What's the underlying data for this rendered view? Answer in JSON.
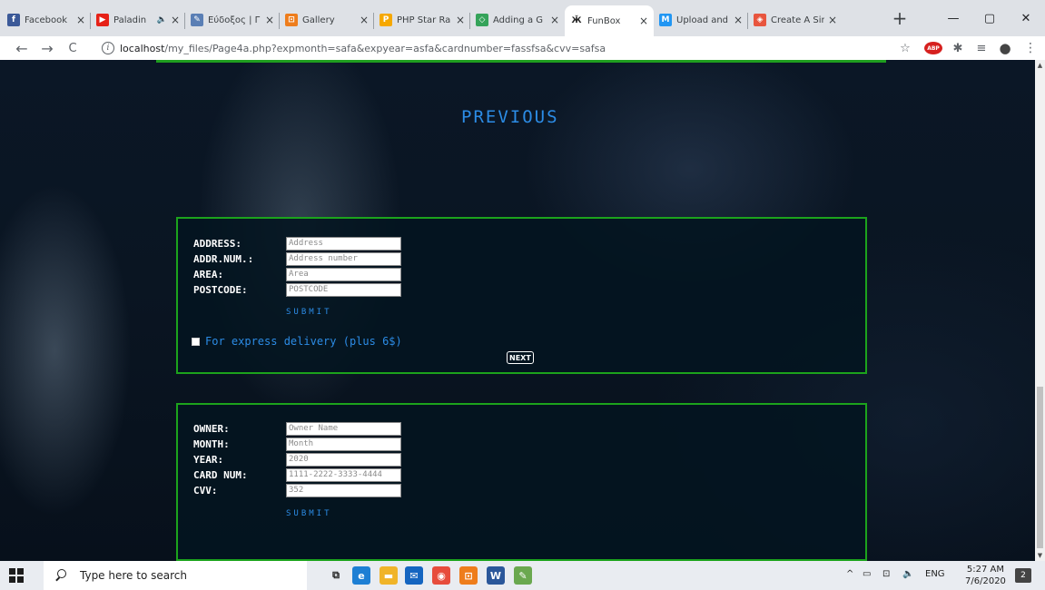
{
  "browser": {
    "tabs": [
      {
        "title": "Facebook",
        "icon": "facebook-icon",
        "color": "#3b5998",
        "glyph": "f"
      },
      {
        "title": "Paladin",
        "icon": "youtube-icon",
        "color": "#e62117",
        "glyph": "▶",
        "audio": "🔈"
      },
      {
        "title": "Εύδοξος | Γ",
        "icon": "eudoxus-icon",
        "color": "#5a7fb5",
        "glyph": "✎"
      },
      {
        "title": "Gallery",
        "icon": "gallery-icon",
        "color": "#ee7d1c",
        "glyph": "⊡"
      },
      {
        "title": "PHP Star Ra",
        "icon": "php-icon",
        "color": "#f6a800",
        "glyph": "P"
      },
      {
        "title": "Adding a G",
        "icon": "code-icon",
        "color": "#35a35a",
        "glyph": "◇"
      },
      {
        "title": "FunBox",
        "icon": "funbox-icon",
        "color": "#ffffff",
        "glyph": "Ӂ"
      },
      {
        "title": "Upload and",
        "icon": "mailchimp-icon",
        "color": "#2196f3",
        "glyph": "M"
      },
      {
        "title": "Create A Sin",
        "icon": "create-icon",
        "color": "#e8553e",
        "glyph": "◈"
      }
    ],
    "close_glyph": "×",
    "new_tab_glyph": "+",
    "window": {
      "minimize": "—",
      "restore": "▢",
      "close": "✕"
    },
    "nav": {
      "back": "←",
      "forward": "→",
      "reload": "C"
    },
    "url_host": "localhost",
    "url_path": "/my_files/Page4a.php?expmonth=safa&expyear=asfa&cardnumber=fassfsa&cvv=safsa",
    "extensions": {
      "star": "☆",
      "abp": "ABP",
      "puzzle": "✱",
      "media": "≡",
      "profile": "●",
      "menu": "⋮"
    }
  },
  "page": {
    "previous_label": "PREVIOUS",
    "address_form": {
      "fields": [
        {
          "label": "ADDRESS:",
          "placeholder": "Address"
        },
        {
          "label": "ADDR.NUM.:",
          "placeholder": "Address number"
        },
        {
          "label": "AREA:",
          "placeholder": "Area"
        },
        {
          "label": "POSTCODE:",
          "placeholder": "POSTCODE"
        }
      ],
      "submit_label": "SUBMIT",
      "express_label": "For express delivery (plus 6$)",
      "next_label": "NEXT"
    },
    "card_form": {
      "fields": [
        {
          "label": "OWNER:",
          "placeholder": "Owner Name"
        },
        {
          "label": "MONTH:",
          "placeholder": "Month"
        },
        {
          "label": "YEAR:",
          "placeholder": "2020"
        },
        {
          "label": "CARD NUM:",
          "placeholder": "1111-2222-3333-4444"
        },
        {
          "label": "CVV:",
          "placeholder": "352"
        }
      ],
      "submit_label": "SUBMIT"
    },
    "colors": {
      "panel_border": "#1ca31c",
      "link": "#2c8ce6"
    }
  },
  "taskbar": {
    "search_placeholder": "Type here to search",
    "apps": [
      {
        "name": "task-view-icon",
        "glyph": "⧉",
        "color": "#e9ecf1"
      },
      {
        "name": "edge-icon",
        "glyph": "e",
        "color": "#1e7fd4"
      },
      {
        "name": "file-explorer-icon",
        "glyph": "▬",
        "color": "#f0b429"
      },
      {
        "name": "mail-icon",
        "glyph": "✉",
        "color": "#1565c0"
      },
      {
        "name": "chrome-icon",
        "glyph": "◉",
        "color": "#e74c3c"
      },
      {
        "name": "gallery-app-icon",
        "glyph": "⊡",
        "color": "#ee7d1c"
      },
      {
        "name": "word-icon",
        "glyph": "W",
        "color": "#2b579a"
      },
      {
        "name": "notepad-icon",
        "glyph": "✎",
        "color": "#6aa84f"
      }
    ],
    "tray": {
      "chevron": "^",
      "network": "▭",
      "wifi": "⊡",
      "volume": "🔈",
      "lang": "ENG"
    },
    "time": "5:27 AM",
    "date": "7/6/2020",
    "notifications": "2"
  }
}
